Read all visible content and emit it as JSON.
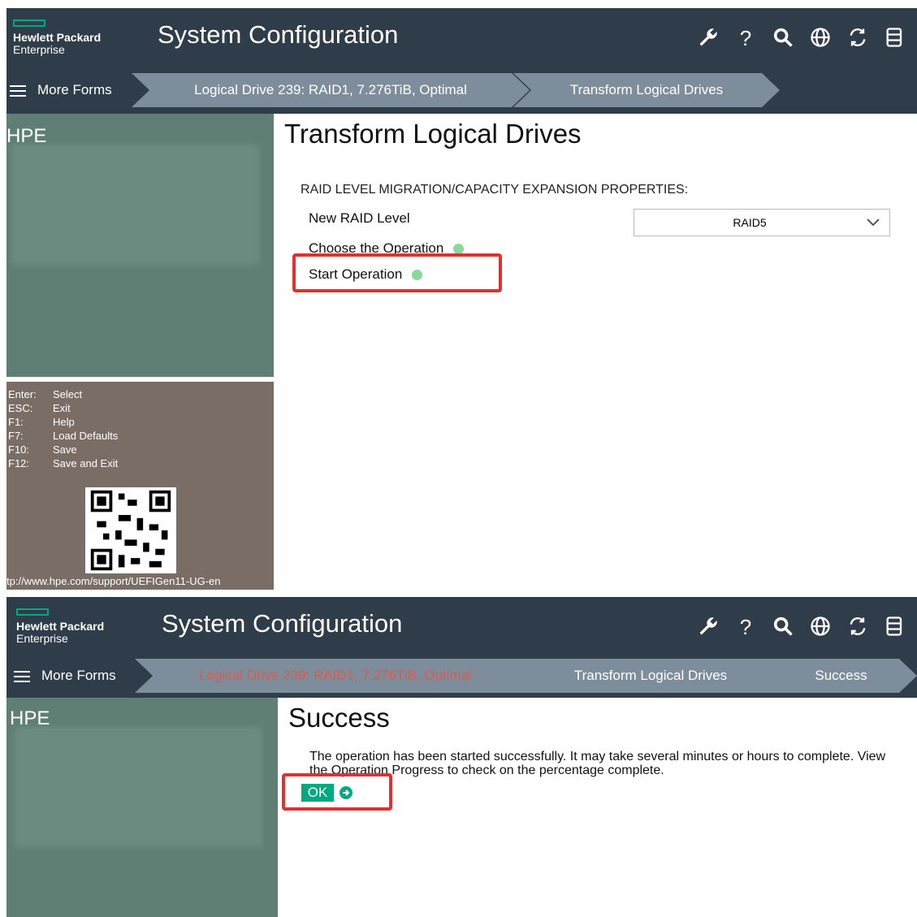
{
  "brand": {
    "line1": "Hewlett Packard",
    "line2": "Enterprise"
  },
  "app_title": "System Configuration",
  "icons": [
    "wrench-icon",
    "help-icon",
    "search-icon",
    "globe-icon",
    "refresh-icon",
    "database-icon"
  ],
  "icon_glyphs": {
    "help": "?"
  },
  "colors": {
    "topbar": "#2f3c49",
    "crumb": "#7d8d9c",
    "sidebar": "#607f74",
    "keys_panel": "#7a6d66",
    "accent": "#01a982",
    "highlight": "#e32f2f"
  },
  "screen1": {
    "nav": {
      "more_forms": "More Forms",
      "crumb1": "Logical Drive 239: RAID1, 7.276TiB, Optimal",
      "crumb2": "Transform Logical Drives"
    },
    "sidebar": {
      "label": "HPE",
      "keys": [
        {
          "key": "Enter:",
          "action": "Select"
        },
        {
          "key": "ESC:",
          "action": "Exit"
        },
        {
          "key": "F1:",
          "action": "Help"
        },
        {
          "key": "F7:",
          "action": "Load Defaults"
        },
        {
          "key": "F10:",
          "action": "Save"
        },
        {
          "key": "F12:",
          "action": "Save and Exit"
        }
      ],
      "url": "tp://www.hpe.com/support/UEFIGen11-UG-en"
    },
    "page": {
      "title": "Transform Logical Drives",
      "section": "RAID LEVEL MIGRATION/CAPACITY EXPANSION PROPERTIES:",
      "raid_label": "New RAID Level",
      "raid_value": "RAID5",
      "choose_op": "Choose the Operation",
      "start_op": "Start Operation"
    }
  },
  "screen2": {
    "nav": {
      "more_forms": "More Forms",
      "crumb1": "Logical Drive 239: RAID1, 7.276TiB, Optimal",
      "crumb2": "Transform Logical Drives",
      "crumb3": "Success"
    },
    "sidebar": {
      "label": "HPE"
    },
    "page": {
      "title": "Success",
      "message": "The operation has been started successfully. It may take several minutes or hours to complete. View the Operation Progress to check on the percentage complete.",
      "ok": "OK"
    }
  }
}
